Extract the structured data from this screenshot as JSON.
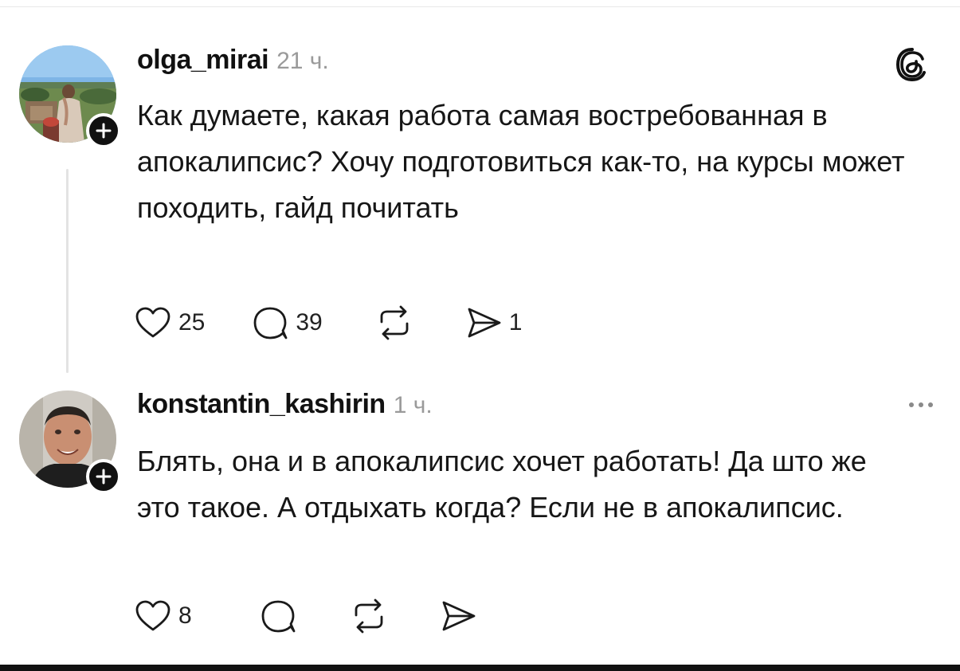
{
  "app": {
    "name": "Threads"
  },
  "posts": [
    {
      "username": "olga_mirai",
      "time": "21 ч.",
      "text": "Как думаете, какая работа самая востребованная в апокалипсис? Хочу подготовиться как-то, на курсы может походить, гайд почитать",
      "likes": "25",
      "replies": "39",
      "shares": "1",
      "avatar_icon": "landscape-photo-avatar",
      "follow_icon": "plus-icon"
    },
    {
      "username": "konstantin_kashirin",
      "time": "1 ч.",
      "text": "Блять, она и в апокалипсис хочет работать! Да што же это такое. А отдыхать когда? Если не в апокалипсис.",
      "likes": "8",
      "avatar_icon": "man-portrait-avatar",
      "follow_icon": "plus-icon"
    }
  ],
  "icons": {
    "like": "heart-icon",
    "reply": "comment-bubble-icon",
    "repost": "repost-arrows-icon",
    "share": "send-paper-plane-icon",
    "more": "more-dots-icon",
    "brand": "threads-logo-icon"
  },
  "colors": {
    "text": "#111111",
    "muted": "#9a9a9a",
    "thread_line": "#e3e3e3",
    "badge": "#111111"
  }
}
